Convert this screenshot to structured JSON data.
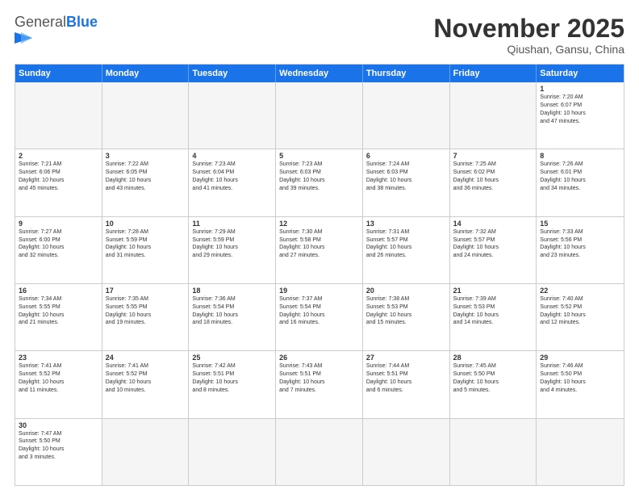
{
  "header": {
    "logo_general": "General",
    "logo_blue": "Blue",
    "month_title": "November 2025",
    "location": "Qiushan, Gansu, China"
  },
  "days_of_week": [
    "Sunday",
    "Monday",
    "Tuesday",
    "Wednesday",
    "Thursday",
    "Friday",
    "Saturday"
  ],
  "weeks": [
    {
      "cells": [
        {
          "day": "",
          "info": ""
        },
        {
          "day": "",
          "info": ""
        },
        {
          "day": "",
          "info": ""
        },
        {
          "day": "",
          "info": ""
        },
        {
          "day": "",
          "info": ""
        },
        {
          "day": "",
          "info": ""
        },
        {
          "day": "1",
          "info": "Sunrise: 7:20 AM\nSunset: 6:07 PM\nDaylight: 10 hours\nand 47 minutes."
        }
      ]
    },
    {
      "cells": [
        {
          "day": "2",
          "info": "Sunrise: 7:21 AM\nSunset: 6:06 PM\nDaylight: 10 hours\nand 45 minutes."
        },
        {
          "day": "3",
          "info": "Sunrise: 7:22 AM\nSunset: 6:05 PM\nDaylight: 10 hours\nand 43 minutes."
        },
        {
          "day": "4",
          "info": "Sunrise: 7:23 AM\nSunset: 6:04 PM\nDaylight: 10 hours\nand 41 minutes."
        },
        {
          "day": "5",
          "info": "Sunrise: 7:23 AM\nSunset: 6:03 PM\nDaylight: 10 hours\nand 39 minutes."
        },
        {
          "day": "6",
          "info": "Sunrise: 7:24 AM\nSunset: 6:03 PM\nDaylight: 10 hours\nand 38 minutes."
        },
        {
          "day": "7",
          "info": "Sunrise: 7:25 AM\nSunset: 6:02 PM\nDaylight: 10 hours\nand 36 minutes."
        },
        {
          "day": "8",
          "info": "Sunrise: 7:26 AM\nSunset: 6:01 PM\nDaylight: 10 hours\nand 34 minutes."
        }
      ]
    },
    {
      "cells": [
        {
          "day": "9",
          "info": "Sunrise: 7:27 AM\nSunset: 6:00 PM\nDaylight: 10 hours\nand 32 minutes."
        },
        {
          "day": "10",
          "info": "Sunrise: 7:28 AM\nSunset: 5:59 PM\nDaylight: 10 hours\nand 31 minutes."
        },
        {
          "day": "11",
          "info": "Sunrise: 7:29 AM\nSunset: 5:59 PM\nDaylight: 10 hours\nand 29 minutes."
        },
        {
          "day": "12",
          "info": "Sunrise: 7:30 AM\nSunset: 5:58 PM\nDaylight: 10 hours\nand 27 minutes."
        },
        {
          "day": "13",
          "info": "Sunrise: 7:31 AM\nSunset: 5:57 PM\nDaylight: 10 hours\nand 26 minutes."
        },
        {
          "day": "14",
          "info": "Sunrise: 7:32 AM\nSunset: 5:57 PM\nDaylight: 10 hours\nand 24 minutes."
        },
        {
          "day": "15",
          "info": "Sunrise: 7:33 AM\nSunset: 5:56 PM\nDaylight: 10 hours\nand 23 minutes."
        }
      ]
    },
    {
      "cells": [
        {
          "day": "16",
          "info": "Sunrise: 7:34 AM\nSunset: 5:55 PM\nDaylight: 10 hours\nand 21 minutes."
        },
        {
          "day": "17",
          "info": "Sunrise: 7:35 AM\nSunset: 5:55 PM\nDaylight: 10 hours\nand 19 minutes."
        },
        {
          "day": "18",
          "info": "Sunrise: 7:36 AM\nSunset: 5:54 PM\nDaylight: 10 hours\nand 18 minutes."
        },
        {
          "day": "19",
          "info": "Sunrise: 7:37 AM\nSunset: 5:54 PM\nDaylight: 10 hours\nand 16 minutes."
        },
        {
          "day": "20",
          "info": "Sunrise: 7:38 AM\nSunset: 5:53 PM\nDaylight: 10 hours\nand 15 minutes."
        },
        {
          "day": "21",
          "info": "Sunrise: 7:39 AM\nSunset: 5:53 PM\nDaylight: 10 hours\nand 14 minutes."
        },
        {
          "day": "22",
          "info": "Sunrise: 7:40 AM\nSunset: 5:52 PM\nDaylight: 10 hours\nand 12 minutes."
        }
      ]
    },
    {
      "cells": [
        {
          "day": "23",
          "info": "Sunrise: 7:41 AM\nSunset: 5:52 PM\nDaylight: 10 hours\nand 11 minutes."
        },
        {
          "day": "24",
          "info": "Sunrise: 7:41 AM\nSunset: 5:52 PM\nDaylight: 10 hours\nand 10 minutes."
        },
        {
          "day": "25",
          "info": "Sunrise: 7:42 AM\nSunset: 5:51 PM\nDaylight: 10 hours\nand 8 minutes."
        },
        {
          "day": "26",
          "info": "Sunrise: 7:43 AM\nSunset: 5:51 PM\nDaylight: 10 hours\nand 7 minutes."
        },
        {
          "day": "27",
          "info": "Sunrise: 7:44 AM\nSunset: 5:51 PM\nDaylight: 10 hours\nand 6 minutes."
        },
        {
          "day": "28",
          "info": "Sunrise: 7:45 AM\nSunset: 5:50 PM\nDaylight: 10 hours\nand 5 minutes."
        },
        {
          "day": "29",
          "info": "Sunrise: 7:46 AM\nSunset: 5:50 PM\nDaylight: 10 hours\nand 4 minutes."
        }
      ]
    },
    {
      "cells": [
        {
          "day": "30",
          "info": "Sunrise: 7:47 AM\nSunset: 5:50 PM\nDaylight: 10 hours\nand 3 minutes."
        },
        {
          "day": "",
          "info": ""
        },
        {
          "day": "",
          "info": ""
        },
        {
          "day": "",
          "info": ""
        },
        {
          "day": "",
          "info": ""
        },
        {
          "day": "",
          "info": ""
        },
        {
          "day": "",
          "info": ""
        }
      ]
    }
  ]
}
